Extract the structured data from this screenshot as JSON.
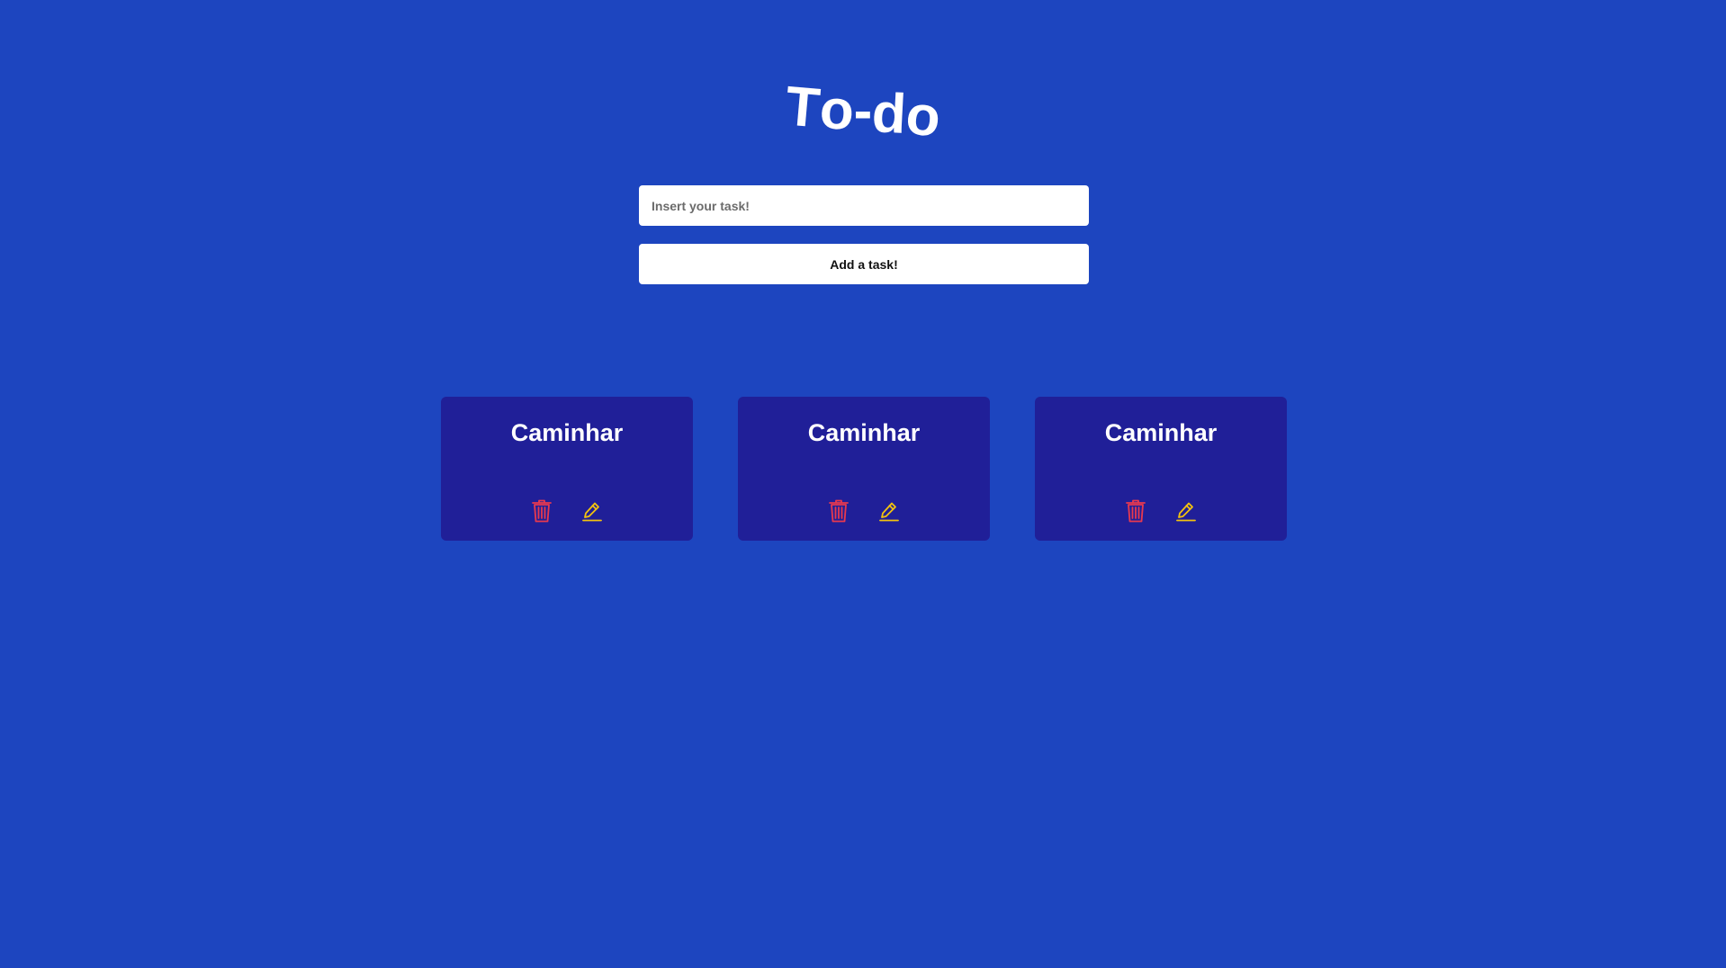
{
  "app": {
    "title_glyphs": [
      "T",
      "o",
      "-",
      "d",
      "o"
    ]
  },
  "form": {
    "input_placeholder": "Insert your task!",
    "input_value": "",
    "add_button_label": "Add a task!"
  },
  "tasks": [
    {
      "title": "Caminhar"
    },
    {
      "title": "Caminhar"
    },
    {
      "title": "Caminhar"
    }
  ],
  "icons": {
    "delete": "trash-icon",
    "edit": "pencil-icon"
  },
  "colors": {
    "background": "#1d45bf",
    "card": "#201f98",
    "delete_icon": "#e8394f",
    "edit_icon": "#f2c20f",
    "text": "#ffffff"
  }
}
